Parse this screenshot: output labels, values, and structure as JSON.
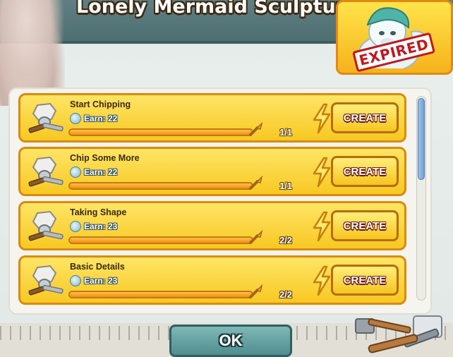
{
  "title": "Lonely Mermaid Sculpture",
  "reward": {
    "status_label": "EXPIRED",
    "image_icon": "unicorn-icon"
  },
  "quests": [
    {
      "name": "Start Chipping",
      "earn_label": "Earn: 22",
      "progress_current": 1,
      "progress_total": 1,
      "count_label": "1/1",
      "button_label": "CREATE",
      "icon": "chisel-stone-icon"
    },
    {
      "name": "Chip Some More",
      "earn_label": "Earn: 22",
      "progress_current": 1,
      "progress_total": 1,
      "count_label": "1/1",
      "button_label": "CREATE",
      "icon": "chisel-stone-icon"
    },
    {
      "name": "Taking Shape",
      "earn_label": "Earn: 23",
      "progress_current": 2,
      "progress_total": 2,
      "count_label": "2/2",
      "button_label": "CREATE",
      "icon": "chisel-stone-icon"
    },
    {
      "name": "Basic Details",
      "earn_label": "Earn: 23",
      "progress_current": 2,
      "progress_total": 2,
      "count_label": "2/2",
      "button_label": "CREATE",
      "icon": "chisel-stone-icon"
    }
  ],
  "footer": {
    "ok_label": "OK"
  },
  "colors": {
    "accent": "#f7c822",
    "border": "#d98a10",
    "expired": "#c0171f"
  }
}
